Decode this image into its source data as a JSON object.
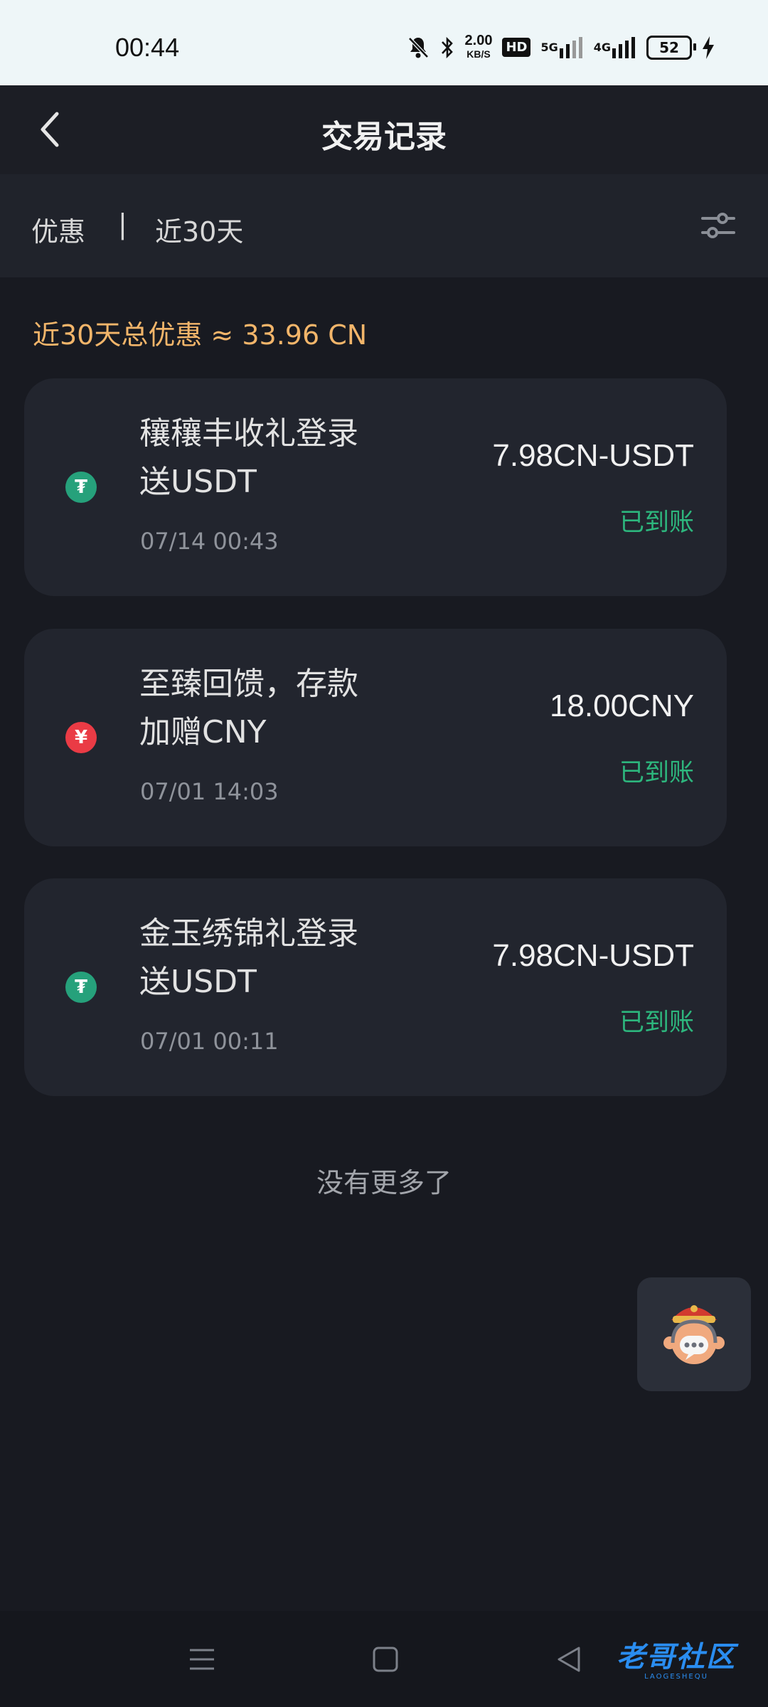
{
  "status_bar": {
    "time": "00:44",
    "net_speed_value": "2.00",
    "net_speed_unit": "KB/S",
    "hd_badge": "HD",
    "signal_5g": "5G",
    "signal_4g": "4G",
    "battery_level": "52",
    "icons": [
      "mute-bell-icon",
      "bluetooth-icon",
      "signal-icon",
      "charging-icon"
    ]
  },
  "header": {
    "title": "交易记录"
  },
  "filter": {
    "type": "优惠",
    "separator": "|",
    "range": "近30天"
  },
  "summary": "近30天总优惠 ≈ 33.96 CN",
  "records": [
    {
      "icon": "usdt-icon",
      "icon_glyph": "₮",
      "title": "穰穰丰收礼登录送USDT",
      "date": "07/14 00:43",
      "amount": "7.98CN-USDT",
      "status": "已到账"
    },
    {
      "icon": "cny-icon",
      "icon_glyph": "¥",
      "title": "至臻回馈，存款加赠CNY",
      "date": "07/01 14:03",
      "amount": "18.00CNY",
      "status": "已到账"
    },
    {
      "icon": "usdt-icon",
      "icon_glyph": "₮",
      "title": "金玉绣锦礼登录送USDT",
      "date": "07/01 00:11",
      "amount": "7.98CN-USDT",
      "status": "已到账"
    }
  ],
  "end_note": "没有更多了",
  "watermark": {
    "text": "老哥社区",
    "sub": "LAOGESHEQU"
  },
  "colors": {
    "background": "#181a21",
    "card": "#22252e",
    "accent_orange": "#f2b56a",
    "status_green": "#2db67d",
    "usdt_green": "#26a17b",
    "cny_red": "#ea3b45"
  }
}
